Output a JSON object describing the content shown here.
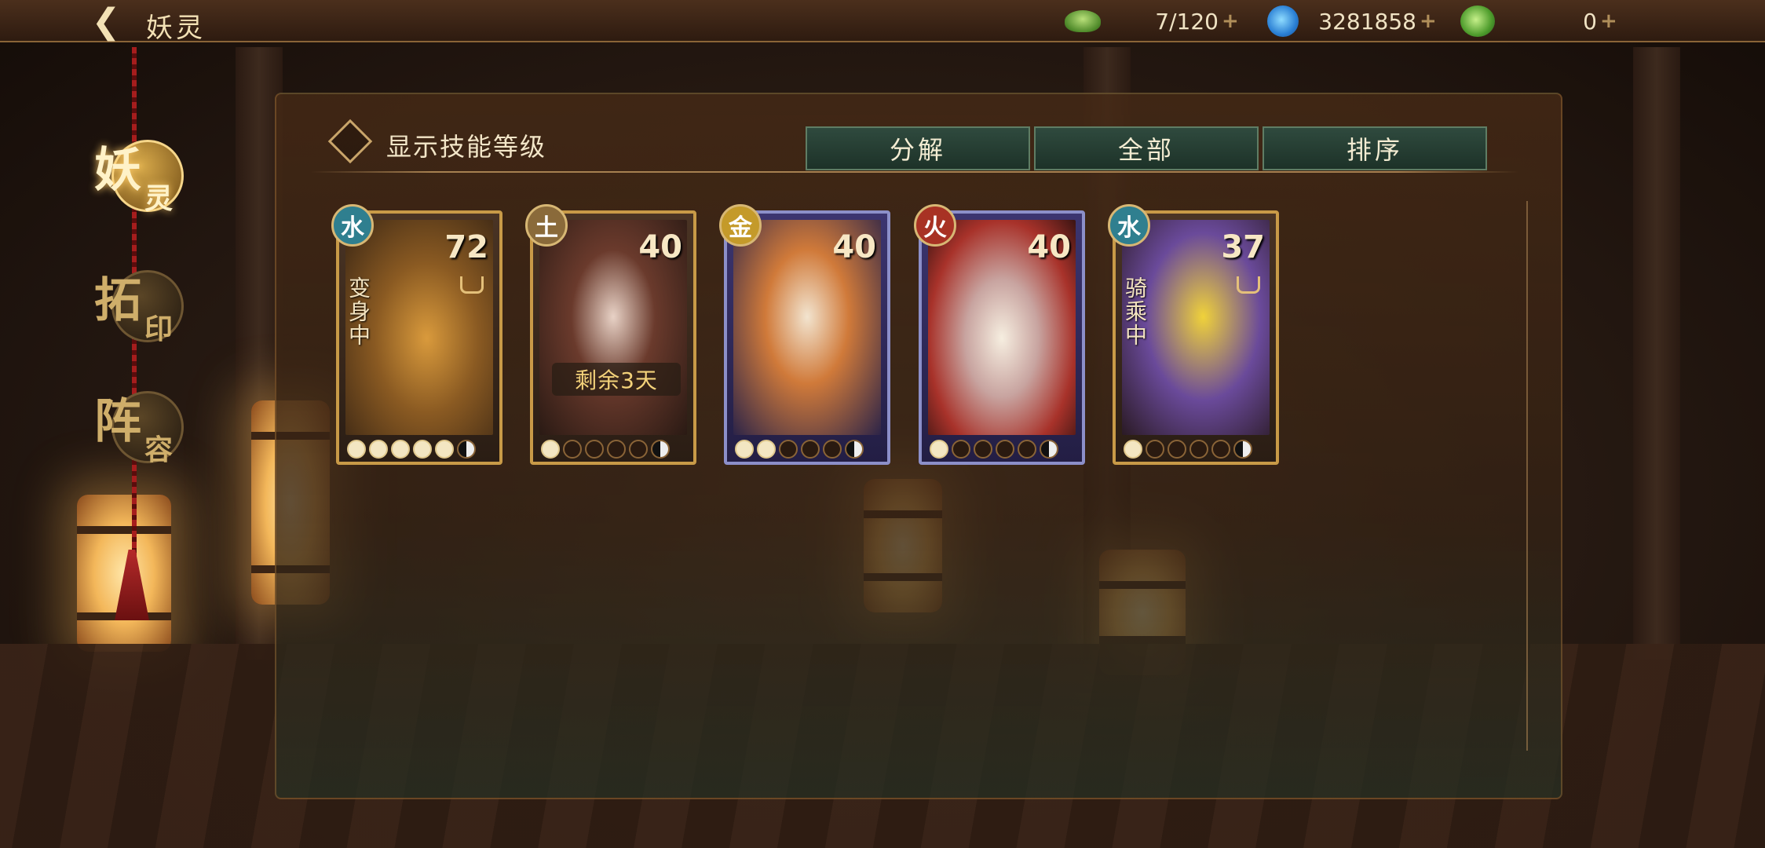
{
  "header": {
    "title": "妖灵"
  },
  "resources": [
    {
      "icon": "green-jade-icon",
      "value": "7/120"
    },
    {
      "icon": "blue-gourd-icon",
      "value": "3281858"
    },
    {
      "icon": "green-coin-icon",
      "value": "0"
    }
  ],
  "sidebar": {
    "items": [
      {
        "ch1": "妖",
        "ch2": "灵",
        "active": true
      },
      {
        "ch1": "拓",
        "ch2": "印",
        "active": false
      },
      {
        "ch1": "阵",
        "ch2": "容",
        "active": false
      }
    ]
  },
  "panel": {
    "checkbox_label": "显示技能等级",
    "tabs": [
      "分解",
      "全部",
      "排序"
    ]
  },
  "cards": [
    {
      "element": "水",
      "level": "72",
      "status": "变身中",
      "remain": "",
      "frame": "gold"
    },
    {
      "element": "土",
      "level": "40",
      "status": "",
      "remain": "剩余3天",
      "frame": "gold"
    },
    {
      "element": "金",
      "level": "40",
      "status": "",
      "remain": "",
      "frame": "purple"
    },
    {
      "element": "火",
      "level": "40",
      "status": "",
      "remain": "",
      "frame": "purple"
    },
    {
      "element": "水",
      "level": "37",
      "status": "骑乘中",
      "remain": "",
      "frame": "gold"
    }
  ],
  "colors": {
    "water": "#2f7f8f",
    "earth": "#8a6a3a",
    "metal": "#c49a2a",
    "fire": "#a83224",
    "gold_frame": "#c89a47",
    "purple_frame": "#8c8fc9"
  }
}
